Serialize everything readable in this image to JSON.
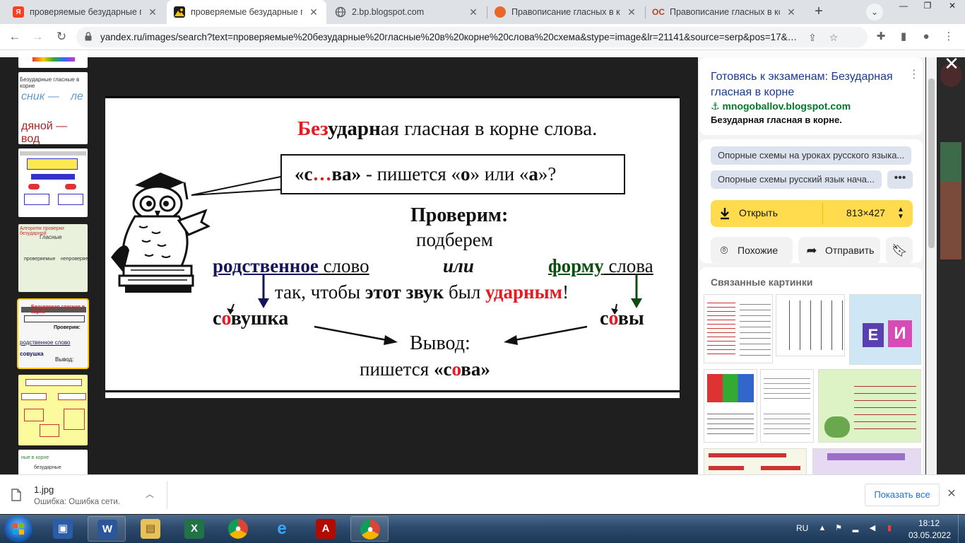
{
  "browser": {
    "tabs": [
      {
        "title": "проверяемые безударные гла",
        "favicon": "yandex-icon",
        "favicon_color": "#fc3f1d",
        "favicon_text": "Я",
        "active": false
      },
      {
        "title": "проверяемые безударные гл",
        "favicon": "yandex-images-icon",
        "favicon_color": "#f5c400",
        "favicon_text": "",
        "active": true
      },
      {
        "title": "2.bp.blogspot.com",
        "favicon": "globe-icon",
        "favicon_color": "#5f6368",
        "favicon_text": "",
        "active": false
      },
      {
        "title": "Правописание гласных в кор",
        "favicon": "fox-icon",
        "favicon_color": "#e8672a",
        "favicon_text": "",
        "active": false
      },
      {
        "title": "Правописание гласных в кор",
        "favicon": "school-icon",
        "favicon_color": "#b0462b",
        "favicon_text": "ОС",
        "active": false
      }
    ],
    "new_tab_label": "+",
    "url": "yandex.ru/images/search?text=проверяемые%20безударные%20гласные%20в%20корне%20слова%20схема&stype=image&lr=21141&source=serp&pos=17&…"
  },
  "viewer": {
    "close_label": "✕",
    "image": {
      "title_parts": {
        "red1": "Без",
        "plain1": "удар",
        "bold1": "н",
        "plain2": "ая гласная в корне слова."
      },
      "question_parts": {
        "q1": "«с",
        "dots": "…",
        "q2": "ва»",
        "q3": " - пишется «",
        "o": "о",
        "q4": "» или «",
        "a": "а",
        "q5": "»?"
      },
      "check_heading": "Проверим:",
      "pick_line": "подберем",
      "kin_word": "родственное",
      "word_after_kin": " слово",
      "or_word": "или",
      "form_word": "форму",
      "word_after_form": " слова",
      "so_that_parts": {
        "p1": "так, чтобы ",
        "p2": "этот звук",
        "p3": " был ",
        "p4": "ударным",
        "p5": "!"
      },
      "example_left_parts": {
        "a": "с",
        "b": "о",
        "c": "вушка"
      },
      "example_right_parts": {
        "a": "с",
        "b": "о",
        "c": "вы"
      },
      "conclusion": "Вывод:",
      "result_parts": {
        "a": "пишется ",
        "b": "«с",
        "c": "о",
        "d": "ва»"
      }
    }
  },
  "side_panel": {
    "title": "Готовясь к экзаменам: Безударная гласная в корне",
    "more_icon": "kebab-icon",
    "source": "⚓ mnogoballov.blogspot.com",
    "description": "Безударная гласная в корне.",
    "chips": [
      "Опорные схемы на уроках русского языка...",
      "Опорные схемы русский язык нача..."
    ],
    "chip_more": "•••",
    "open_label": "Открыть",
    "size_label": "813×427",
    "similar_label": "Похожие",
    "share_label": "Отправить",
    "related_title": "Связанные картинки"
  },
  "download_bar": {
    "file_name": "1.jpg",
    "status": "Ошибка: Ошибка сети.",
    "show_all": "Показать все"
  },
  "taskbar": {
    "apps": [
      "word-save-icon",
      "word-icon",
      "explorer-icon",
      "excel-icon",
      "chrome-icon",
      "ie-icon",
      "acrobat-icon",
      "chrome-icon"
    ],
    "lang": "RU",
    "time": "18:12",
    "date": "03.05.2022"
  },
  "colors": {
    "accent_yellow": "#ffdb4d",
    "link_blue": "#1a3c8f",
    "source_green": "#007a28",
    "image_red": "#e31b23",
    "image_navy": "#14145a",
    "image_green": "#0d4d12"
  }
}
